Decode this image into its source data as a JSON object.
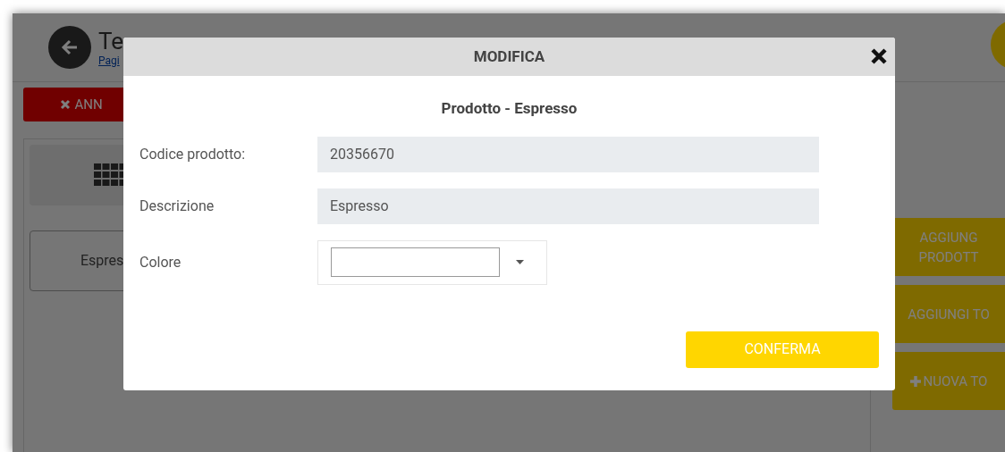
{
  "page": {
    "title": "Te",
    "link": "Pagi",
    "cancel_button": "ANN",
    "product_tiles": [
      "Espres"
    ],
    "side_buttons": [
      {
        "kind": "plain",
        "lines": [
          "AGGIUNG",
          "PRODOTT"
        ]
      },
      {
        "kind": "plain",
        "lines": [
          "AGGIUNGI TO"
        ]
      },
      {
        "kind": "add",
        "lines": [
          "NUOVA TO"
        ]
      }
    ]
  },
  "modal": {
    "title": "MODIFICA",
    "subtitle": "Prodotto - Espresso",
    "fields": [
      {
        "kind": "text",
        "label": "Codice prodotto:",
        "value": "20356670"
      },
      {
        "kind": "text",
        "label": "Descrizione",
        "value": "Espresso"
      },
      {
        "kind": "color",
        "label": "Colore"
      }
    ],
    "confirm_button": "CONFERMA"
  }
}
